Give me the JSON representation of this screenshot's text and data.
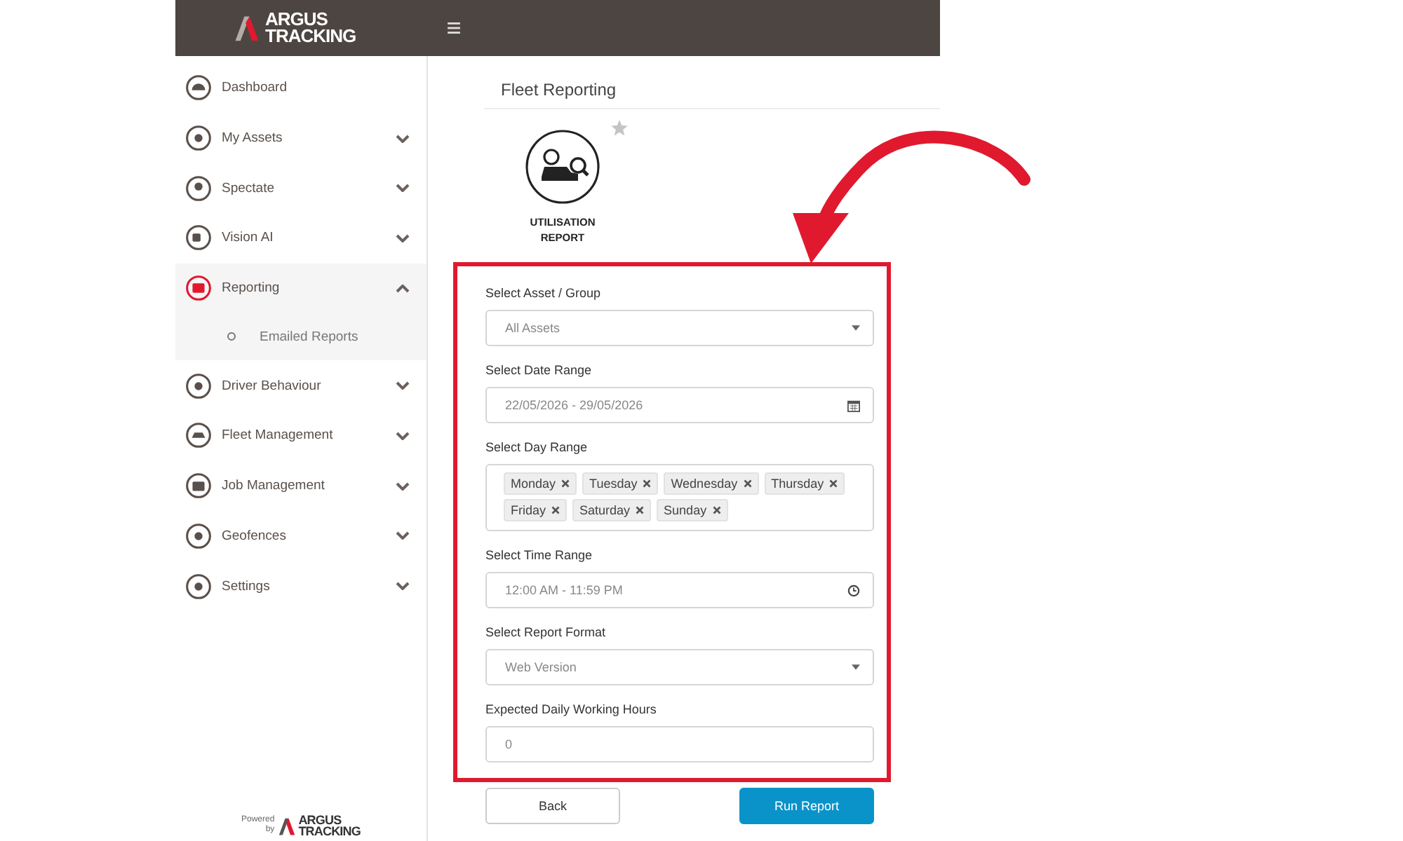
{
  "header": {
    "logo": {
      "line_1": "ARGUS",
      "line_2": "TRACKING"
    }
  },
  "sidebar": {
    "items": [
      {
        "label": "Dashboard",
        "expandable": false,
        "selected": false
      },
      {
        "label": "My Assets",
        "expandable": true,
        "expanded": false,
        "selected": false
      },
      {
        "label": "Spectate",
        "expandable": true,
        "expanded": false,
        "selected": false
      },
      {
        "label": "Vision AI",
        "expandable": true,
        "expanded": false,
        "selected": false
      },
      {
        "label": "Reporting",
        "expandable": true,
        "expanded": true,
        "selected": true,
        "children": [
          {
            "label": "Emailed Reports"
          }
        ]
      },
      {
        "label": "Driver Behaviour",
        "expandable": true,
        "expanded": false,
        "selected": false
      },
      {
        "label": "Fleet Management",
        "expandable": true,
        "expanded": false,
        "selected": false
      },
      {
        "label": "Job Management",
        "expandable": true,
        "expanded": false,
        "selected": false
      },
      {
        "label": "Geofences",
        "expandable": true,
        "expanded": false,
        "selected": false
      },
      {
        "label": "Settings",
        "expandable": true,
        "expanded": false,
        "selected": false
      }
    ],
    "footer": {
      "powered": "Powered",
      "by": "by",
      "logo": {
        "line_1": "ARGUS",
        "line_2": "TRACKING"
      }
    }
  },
  "page": {
    "title": "Fleet Reporting",
    "report_tile": {
      "label": "UTILISATION REPORT",
      "favorite": false
    }
  },
  "form": {
    "fields": [
      {
        "kind": "select",
        "label": "Select Asset / Group",
        "value": "All Assets"
      },
      {
        "kind": "date",
        "label": "Select Date Range",
        "value": "22/05/2026 - 29/05/2026"
      },
      {
        "kind": "tags",
        "label": "Select Day Range",
        "tags": [
          "Monday",
          "Tuesday",
          "Wednesday",
          "Thursday",
          "Friday",
          "Saturday",
          "Sunday"
        ]
      },
      {
        "kind": "time",
        "label": "Select Time Range",
        "value": "12:00 AM - 11:59 PM"
      },
      {
        "kind": "select",
        "label": "Select Report Format",
        "value": "Web Version"
      },
      {
        "kind": "text",
        "label": "Expected Daily Working Hours",
        "value": "0"
      }
    ]
  },
  "buttons": [
    {
      "label": "Back",
      "kind": "secondary"
    },
    {
      "label": "Run Report",
      "kind": "primary"
    }
  ]
}
